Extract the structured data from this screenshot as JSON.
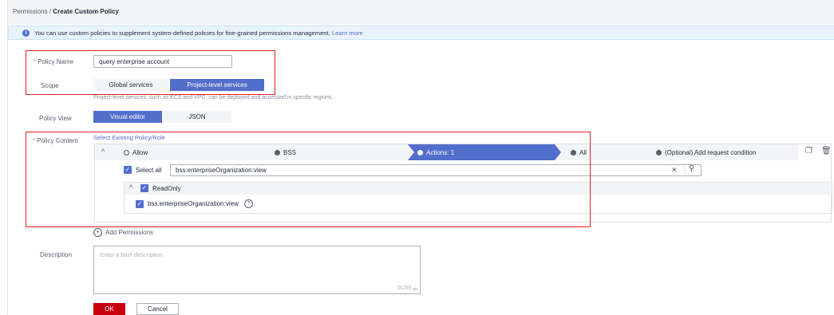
{
  "breadcrumb": {
    "parent": "Permissions",
    "separator": " / ",
    "current": "Create Custom Policy"
  },
  "info": {
    "text": "You can use custom policies to supplement system-defined policies for fine-grained permissions management.",
    "link": "Learn more"
  },
  "form": {
    "policy_name_label": "Policy Name",
    "policy_name_value": "query enterprise account",
    "scope_label": "Scope",
    "scope_options": [
      "Global services",
      "Project-level services"
    ],
    "scope_hint": "Project-level services, such as ECS and VPC, can be deployed and accessed in specific regions.",
    "policy_view_label": "Policy View",
    "policy_view_options": [
      "Visual editor",
      "JSON"
    ],
    "policy_content_label": "Policy Content",
    "select_existing_link": "Select Existing Policy/Role",
    "description_label": "Description",
    "description_placeholder": "Enter a brief description.",
    "description_counter": "0/255"
  },
  "editor": {
    "steps": [
      "Allow",
      "BSS",
      "Actions: 1",
      "All",
      "(Optional) Add request condition"
    ],
    "select_all_label": "Select all",
    "search_value": "bss:enterpriseOrganization:view",
    "group_label": "ReadOnly",
    "action_item": "bss:enterpriseOrganization:view",
    "add_permissions": "Add Permissions"
  },
  "buttons": {
    "ok": "OK",
    "cancel": "Cancel"
  },
  "colors": {
    "accent": "#526ecc",
    "highlight_box": "#e02020",
    "ok_button": "#c7000b",
    "required": "#f66f6a"
  }
}
